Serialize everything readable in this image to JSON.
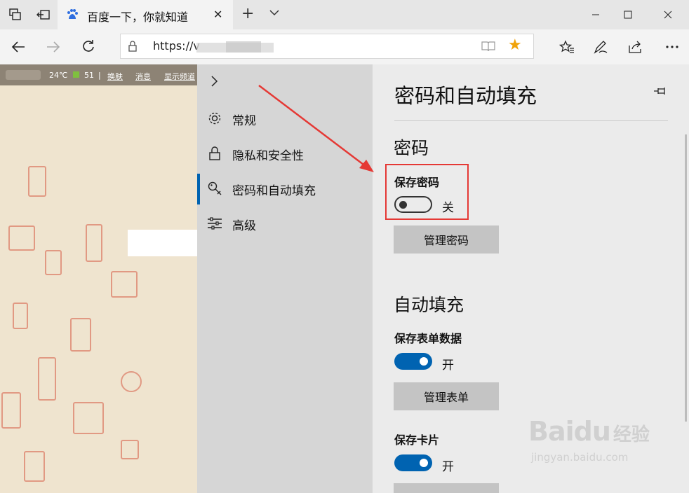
{
  "tab": {
    "title": "百度一下，你就知道"
  },
  "address": {
    "url_text": "https://v"
  },
  "page": {
    "weather": "24℃",
    "aqi": "51",
    "sep": "|",
    "links": [
      "换肤",
      "消息",
      "显示频道"
    ]
  },
  "menu": {
    "items": [
      {
        "label": "常规"
      },
      {
        "label": "隐私和安全性"
      },
      {
        "label": "密码和自动填充"
      },
      {
        "label": "高级"
      }
    ]
  },
  "panel": {
    "title": "密码和自动填充",
    "password_section": "密码",
    "save_password_label": "保存密码",
    "save_password_state": "关",
    "manage_passwords_label": "管理密码",
    "autofill_section": "自动填充",
    "save_form_label": "保存表单数据",
    "save_form_state": "开",
    "manage_forms_label": "管理表单",
    "save_cards_label": "保存卡片",
    "save_cards_state": "开"
  },
  "watermark": {
    "brand": "Bai",
    "brand2": "du",
    "cn": "经验",
    "sub": "jingyan.baidu.com"
  },
  "colors": {
    "accent": "#0063b1",
    "highlight": "#e53935",
    "star": "#f0a30a"
  }
}
